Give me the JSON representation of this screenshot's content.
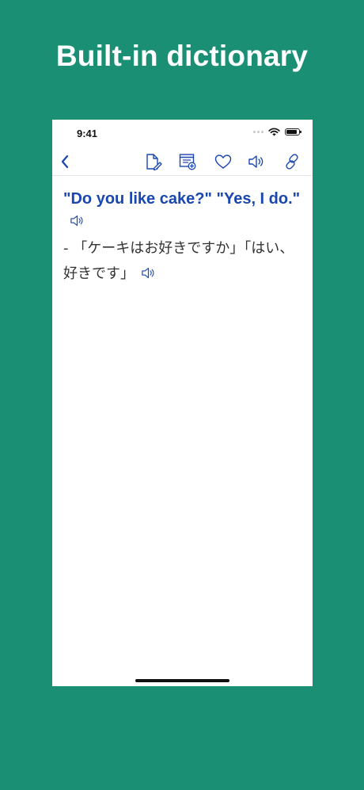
{
  "headline": "Built-in dictionary",
  "status_bar": {
    "time": "9:41"
  },
  "toolbar": {
    "icons": [
      "back-chevron-icon",
      "note-edit-icon",
      "add-to-list-icon",
      "heart-icon",
      "speaker-icon",
      "link-icon"
    ],
    "accent_color": "#1a46b0"
  },
  "entry": {
    "phrase": "\"Do you like cake?\" \"Yes, I do.\"",
    "translation": "- 「ケーキはお好きですか」「はい、好きです」"
  },
  "colors": {
    "background": "#1a8f74",
    "headline": "#ffffff",
    "phrase": "#1a46b0",
    "text": "#333333"
  }
}
